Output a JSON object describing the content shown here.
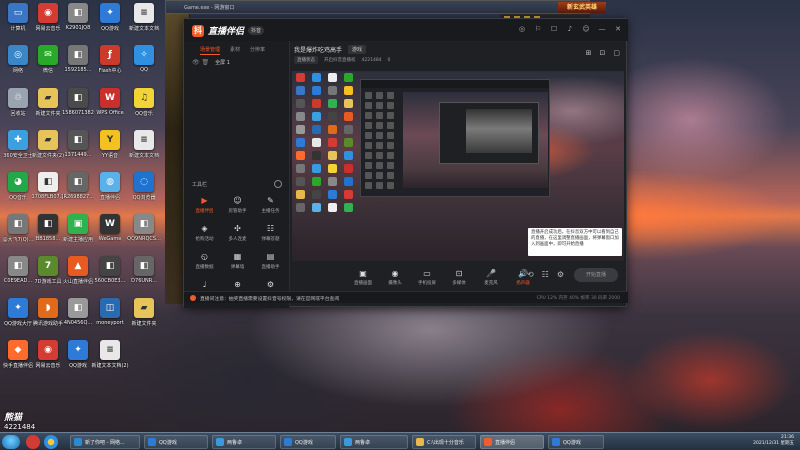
{
  "background_window": {
    "title": "Game.exe - 网游窗口",
    "banner": "新玄武英雄"
  },
  "desktop_icons": [
    {
      "label": "计算机",
      "color": "#3a76c4",
      "glyph": "▭"
    },
    {
      "label": "网易云音乐",
      "color": "#d43c33",
      "glyph": "◉"
    },
    {
      "label": "K2901JQ8",
      "color": "#888888",
      "glyph": "◧"
    },
    {
      "label": "QQ游戏",
      "color": "#2d7bd6",
      "glyph": "✦"
    },
    {
      "label": "新建文本文档",
      "color": "#e8e8e8",
      "glyph": "≡"
    },
    {
      "label": "网络",
      "color": "#3b86c7",
      "glyph": "◎"
    },
    {
      "label": "微信",
      "color": "#2aa82a",
      "glyph": "✉"
    },
    {
      "label": "1592185...",
      "color": "#777777",
      "glyph": "◧"
    },
    {
      "label": "Flash中心",
      "color": "#cc3a2c",
      "glyph": "ƒ"
    },
    {
      "label": "QQ",
      "color": "#2f8fe0",
      "glyph": "✧"
    },
    {
      "label": "回收站",
      "color": "#9aa4b0",
      "glyph": "♲"
    },
    {
      "label": "新建文件夹",
      "color": "#e7c45a",
      "glyph": "▰"
    },
    {
      "label": "1586071382",
      "color": "#4a4a4a",
      "glyph": "◧"
    },
    {
      "label": "WPS Office",
      "color": "#c9302c",
      "glyph": "W"
    },
    {
      "label": "QQ音乐",
      "color": "#f2d436",
      "glyph": "♫"
    },
    {
      "label": "360安全卫士",
      "color": "#3aa0e0",
      "glyph": "✚"
    },
    {
      "label": "新建文件夹(2)",
      "color": "#e7c45a",
      "glyph": "▰"
    },
    {
      "label": "1371449...",
      "color": "#555555",
      "glyph": "◧"
    },
    {
      "label": "YY语音",
      "color": "#f3c121",
      "glyph": "Y"
    },
    {
      "label": "新建文本文档",
      "color": "#e8e8e8",
      "glyph": "≡"
    },
    {
      "label": "QQ音乐",
      "color": "#22a848",
      "glyph": "◕"
    },
    {
      "label": "1708FLB07...",
      "color": "#eeeeee",
      "glyph": "◧"
    },
    {
      "label": "JR2698827...",
      "color": "#666666",
      "glyph": "◧"
    },
    {
      "label": "直播伴侣",
      "color": "#5ab1ea",
      "glyph": "◍"
    },
    {
      "label": "QQ浏览器",
      "color": "#1e73d1",
      "glyph": "◌"
    },
    {
      "label": "@大飞7(Q)...",
      "color": "#777777",
      "glyph": "◧"
    },
    {
      "label": "BB1858...",
      "color": "#333333",
      "glyph": "◧"
    },
    {
      "label": "新建主播应用",
      "color": "#2fb34f",
      "glyph": "▣"
    },
    {
      "label": "WeGame",
      "color": "#333333",
      "glyph": "W"
    },
    {
      "label": "QQ9NRQCS...",
      "color": "#888888",
      "glyph": "◧"
    },
    {
      "label": "C0E9EAD...",
      "color": "#888888",
      "glyph": "◧"
    },
    {
      "label": "7D游戏工具",
      "color": "#5b8a2d",
      "glyph": "7"
    },
    {
      "label": "火山直播伴侣",
      "color": "#e85a20",
      "glyph": "▲"
    },
    {
      "label": "560CB0E3...",
      "color": "#444444",
      "glyph": "◧"
    },
    {
      "label": "D76UNR...",
      "color": "#666666",
      "glyph": "◧"
    },
    {
      "label": "QQ游戏大厅",
      "color": "#2d7bd6",
      "glyph": "✦"
    },
    {
      "label": "腾讯游戏助手",
      "color": "#e06a1c",
      "glyph": "◗"
    },
    {
      "label": "4N0456Q...",
      "color": "#999999",
      "glyph": "◧"
    },
    {
      "label": "moneyport",
      "color": "#2a6ab0",
      "glyph": "◫"
    },
    {
      "label": "新建文件夹",
      "color": "#e7c45a",
      "glyph": "▰"
    },
    {
      "label": "快手直播伴侣",
      "color": "#ff6b2c",
      "glyph": "◆"
    },
    {
      "label": "网易云音乐",
      "color": "#d43c33",
      "glyph": "◉"
    },
    {
      "label": "QQ游戏",
      "color": "#2d7bd6",
      "glyph": "✦"
    },
    {
      "label": "新建文本文档(2)",
      "color": "#e8e8e8",
      "glyph": "≡"
    }
  ],
  "app": {
    "logo_glyph": "抖",
    "name": "直播伴侣",
    "version": "抖音",
    "header_icons": [
      "◎",
      "⚐",
      "☐",
      "♪",
      "☺",
      "—",
      "✕"
    ],
    "tabs": [
      "场景管理",
      "素材",
      "分辨率"
    ],
    "scene_icons": "👁 🗑",
    "scene_name": "全屏 1",
    "tools_title": "工具栏",
    "tools": [
      {
        "label": "直播伴侣",
        "glyph": "▶",
        "hot": true
      },
      {
        "label": "房管助手",
        "glyph": "☺",
        "hot": false
      },
      {
        "label": "主播任务",
        "glyph": "✎",
        "hot": false
      },
      {
        "label": "抢购活动",
        "glyph": "◈",
        "hot": false
      },
      {
        "label": "多人连麦",
        "glyph": "✣",
        "hot": false
      },
      {
        "label": "弹幕答题",
        "glyph": "☷",
        "hot": false
      },
      {
        "label": "直播数据",
        "glyph": "◵",
        "hot": false
      },
      {
        "label": "弹幕墙",
        "glyph": "▦",
        "hot": false
      },
      {
        "label": "直播助手",
        "glyph": "▤",
        "hot": false
      },
      {
        "label": "音效",
        "glyph": "♩",
        "hot": false
      },
      {
        "label": "更多",
        "glyph": "⊕",
        "hot": false
      },
      {
        "label": "设置",
        "glyph": "⚙",
        "hot": false
      }
    ],
    "room_title": "我是爆炸吃鸡高手",
    "category": "游戏",
    "badge": "直播状态",
    "room_info": "开启抖音直播权",
    "room_id": "4221484",
    "fans": "0",
    "main_icons": [
      "⊞",
      "⊡",
      "▢"
    ],
    "tooltip": "直播开启成功后，在抖音双方中可以看到自己的直播，在这里调整直播画面，将弹幕窗口加入到画面中，即可开始直播",
    "controls": [
      {
        "label": "直播画面",
        "glyph": "▣",
        "live": false
      },
      {
        "label": "摄像头",
        "glyph": "◉",
        "live": false
      },
      {
        "label": "手机投屏",
        "glyph": "▭",
        "live": false
      },
      {
        "label": "多媒体",
        "glyph": "⊡",
        "live": false
      },
      {
        "label": "麦克风",
        "glyph": "🎤",
        "live": false
      },
      {
        "label": "扬声器",
        "glyph": "🔊",
        "live": true
      }
    ],
    "right_controls": [
      "⟲",
      "☷",
      "⚙"
    ],
    "start_button": "开始直播",
    "notice": "直播间注意：抽奖直播需要设置抖音号权限，请在官网或平台查阅",
    "stats": "CPU 12%  内存 40%  帧率 30  码率 2000"
  },
  "watermark": {
    "logo": "熊猫",
    "number": "4221484"
  },
  "taskbar": {
    "tasks": [
      {
        "label": "新了你吧 - 网络...",
        "color": "#2a8ad4"
      },
      {
        "label": "QQ游戏",
        "color": "#2d7bd6"
      },
      {
        "label": "两鲁卓",
        "color": "#3a9ae0"
      },
      {
        "label": "QQ游戏",
        "color": "#2d7bd6"
      },
      {
        "label": "两鲁卓",
        "color": "#3a9ae0"
      },
      {
        "label": "C:\\出现十分音乐",
        "color": "#e8b84a"
      },
      {
        "label": "直播伴侣",
        "color": "#f25b2a"
      },
      {
        "label": "QQ游戏",
        "color": "#2d7bd6"
      }
    ],
    "clock_time": "21:36",
    "clock_date": "2021/12/31 星期五"
  }
}
